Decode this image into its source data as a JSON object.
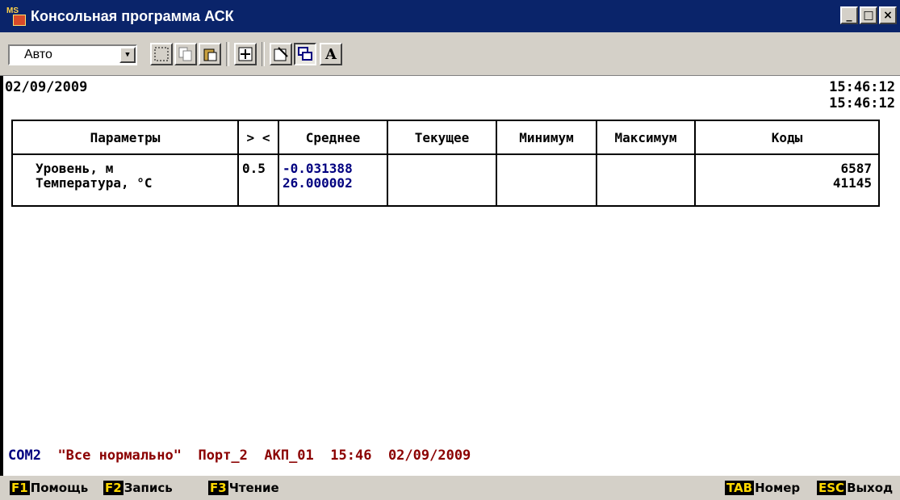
{
  "window": {
    "title": "Консольная программа АСК",
    "buttons": [
      "_",
      "□",
      "×"
    ]
  },
  "toolbar": {
    "font_value": "Авто",
    "icons": [
      "mark-icon",
      "copy-icon",
      "paste-icon",
      "fullscreen-icon",
      "properties-icon",
      "background-icon",
      "font-icon"
    ],
    "font_glyph": "A"
  },
  "console": {
    "date": "02/09/2009",
    "time1": "15:46:12",
    "time2": "15:46:12",
    "table": {
      "headers": [
        "Параметры",
        "> <",
        "Среднее",
        "Текущее",
        "Минимум",
        "Максимум",
        "Коды"
      ],
      "rows": [
        {
          "params": "Уровень, м\nТемпература, °C",
          "threshold": "0.5",
          "mean": "-0.031388\n26.000002",
          "current": "",
          "min": "",
          "max": "",
          "codes": "6587\n41145"
        }
      ]
    },
    "status": {
      "port": "COM2",
      "message": "\"Все нормально\"",
      "port_name": "Порт_2",
      "device": "АКП_01",
      "time": "15:46",
      "date": "02/09/2009"
    }
  },
  "keys": [
    {
      "key": "F1",
      "label": "Помощь"
    },
    {
      "key": "F2",
      "label": "Запись"
    },
    {
      "key": "F3",
      "label": "Чтение"
    },
    {
      "key": "TAB",
      "label": "Номер"
    },
    {
      "key": "ESC",
      "label": "Выход"
    }
  ],
  "colors": {
    "titlebar": "#0a246a",
    "status_text": "#8b0000",
    "value_text": "#000080",
    "key_highlight": "#ffd800"
  }
}
